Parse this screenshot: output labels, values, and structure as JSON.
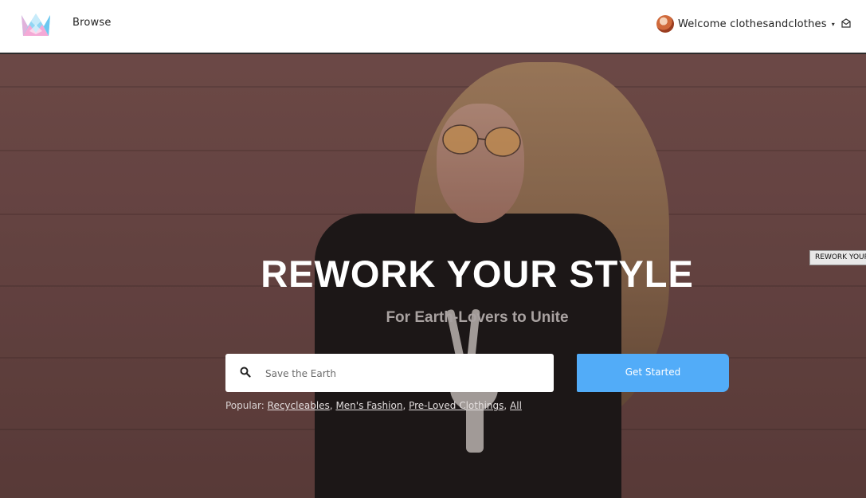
{
  "nav": {
    "browse_label": "Browse",
    "welcome_text": "Welcome clothesandclothes",
    "caret": "▾",
    "logo_colors": [
      "#7fd3f5",
      "#f2a6d4"
    ]
  },
  "hero": {
    "title": "REWORK YOUR STYLE",
    "subtitle": "For Earth-Lovers to Unite",
    "search_placeholder": "Save the Earth",
    "button_label": "Get Started",
    "popular_label": "Popular:",
    "popular_links": [
      "Recycleables",
      "Men's Fashion",
      "Pre-Loved Clothings",
      "All"
    ],
    "side_tag": "REWORK YOUR STYLE"
  },
  "colors": {
    "accent": "#52acf8",
    "navbar_border": "#2b2b2b"
  }
}
